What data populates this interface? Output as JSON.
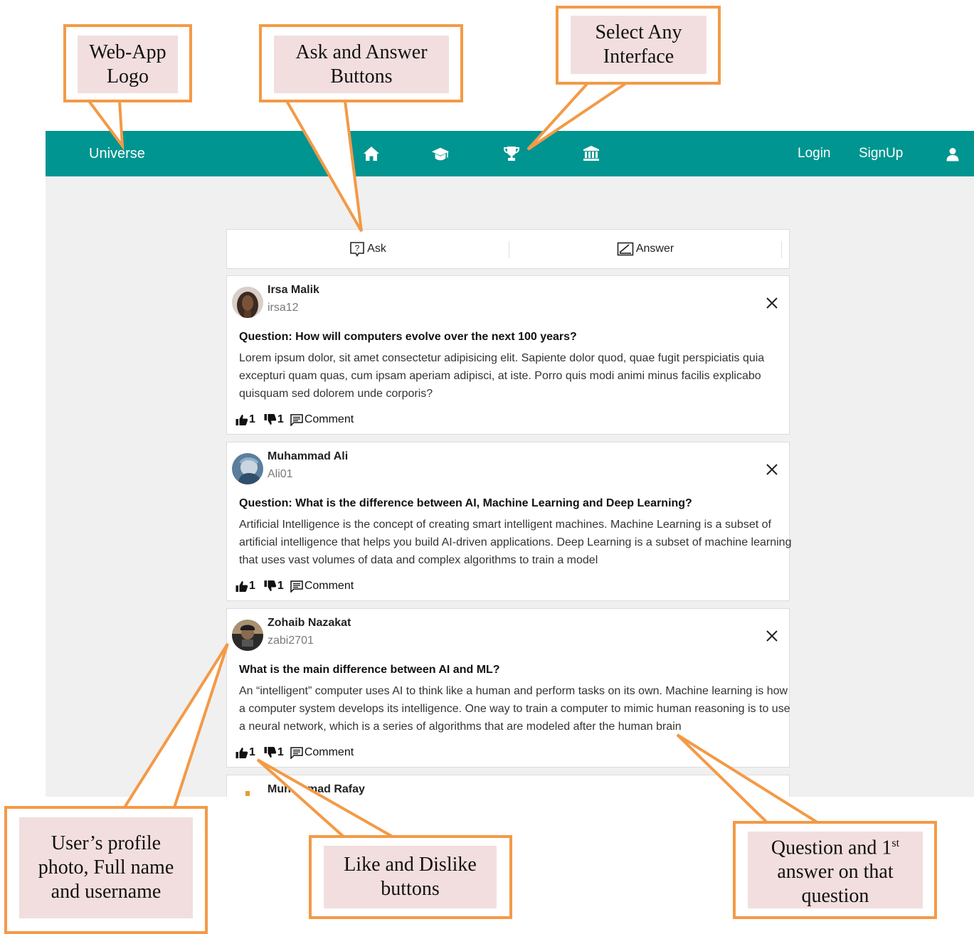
{
  "navbar": {
    "logo": "Universe",
    "icons": [
      "home-icon",
      "graduation-cap-icon",
      "trophy-icon",
      "bank-icon"
    ],
    "login_label": "Login",
    "signup_label": "SignUp",
    "user_icon": "user-icon"
  },
  "tabs": {
    "ask_label": "Ask",
    "answer_label": "Answer"
  },
  "posts": [
    {
      "full_name": "Irsa Malik",
      "username": "irsa12",
      "question": "Question: How will computers evolve over the next 100 years?",
      "answer": "Lorem ipsum dolor, sit amet consectetur adipisicing elit. Sapiente dolor quod, quae fugit perspiciatis quia excepturi quam quas, cum ipsam aperiam adipisci, at iste. Porro quis modi animi minus facilis explicabo quisquam sed dolorem unde corporis?",
      "likes": "1",
      "dislikes": "1",
      "comment_label": "Comment"
    },
    {
      "full_name": "Muhammad Ali",
      "username": "Ali01",
      "question": "Question: What is the difference between AI, Machine Learning and Deep Learning?",
      "answer": "Artificial Intelligence is the concept of creating smart intelligent machines. Machine Learning is a subset of artificial intelligence that helps you build AI-driven applications. Deep Learning is a subset of machine learning that uses vast volumes of data and complex algorithms to train a model",
      "likes": "1",
      "dislikes": "1",
      "comment_label": "Comment"
    },
    {
      "full_name": "Zohaib Nazakat",
      "username": "zabi2701",
      "question": "What is the main difference between AI and ML?",
      "answer": "An “intelligent” computer uses AI to think like a human and perform tasks on its own. Machine learning is how a computer system develops its intelligence. One way to train a computer to mimic human reasoning is to use a neural network, which is a series of algorithms that are modeled after the human brain",
      "likes": "1",
      "dislikes": "1",
      "comment_label": "Comment"
    },
    {
      "full_name": "Muhammad Rafay"
    }
  ],
  "annotations": {
    "logo": [
      "Web-App",
      "Logo"
    ],
    "ask_answer": [
      "Ask and Answer",
      "Buttons"
    ],
    "interface": [
      "Select Any",
      "Interface"
    ],
    "profile": [
      "User’s profile",
      "photo, Full name",
      "and username"
    ],
    "like_dislike": [
      "Like and Dislike",
      "buttons"
    ],
    "question_answer": [
      "Question and 1",
      "st",
      "answer on that",
      "question"
    ]
  },
  "colors": {
    "navbar": "#009590",
    "page_background": "#f0f0f0",
    "annotation_border": "#f39a47",
    "annotation_fill": "#f2dede"
  }
}
